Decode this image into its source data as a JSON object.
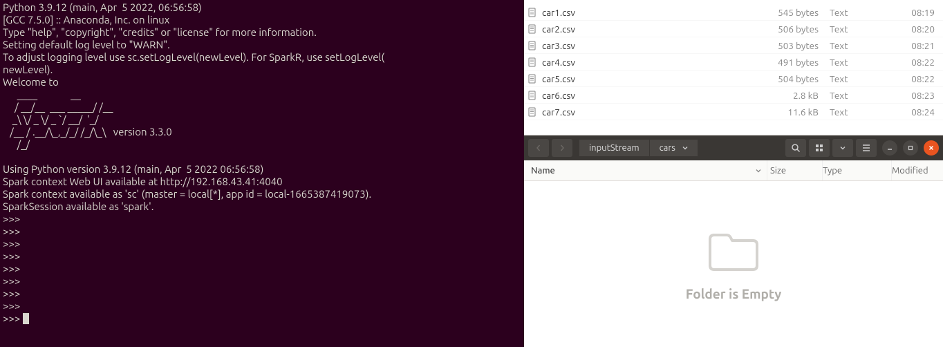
{
  "terminal": {
    "lines": [
      "Python 3.9.12 (main, Apr  5 2022, 06:56:58)",
      "[GCC 7.5.0] :: Anaconda, Inc. on linux",
      "Type \"help\", \"copyright\", \"credits\" or \"license\" for more information.",
      "Setting default log level to \"WARN\".",
      "To adjust logging level use sc.setLogLevel(newLevel). For SparkR, use setLogLevel(",
      "newLevel).",
      "Welcome to",
      "      ____              __",
      "     / __/__  ___ _____/ /__",
      "    _\\ \\/ _ \\/ _ `/ __/  '_/",
      "   /__ / .__/\\_,_/_/ /_/\\_\\   version 3.3.0",
      "      /_/",
      "",
      "Using Python version 3.9.12 (main, Apr  5 2022 06:56:58)",
      "Spark context Web UI available at http://192.168.43.41:4040",
      "Spark context available as 'sc' (master = local[*], app id = local-1665387419073).",
      "SparkSession available as 'spark'.",
      ">>> ",
      ">>> ",
      ">>> ",
      ">>> ",
      ">>> ",
      ">>> ",
      ">>> ",
      ">>> ",
      ">>> "
    ]
  },
  "fm_top": {
    "files": [
      {
        "name": "car1.csv",
        "size": "545 bytes",
        "type": "Text",
        "modified": "08:19"
      },
      {
        "name": "car2.csv",
        "size": "506 bytes",
        "type": "Text",
        "modified": "08:20"
      },
      {
        "name": "car3.csv",
        "size": "503 bytes",
        "type": "Text",
        "modified": "08:21"
      },
      {
        "name": "car4.csv",
        "size": "491 bytes",
        "type": "Text",
        "modified": "08:22"
      },
      {
        "name": "car5.csv",
        "size": "504 bytes",
        "type": "Text",
        "modified": "08:22"
      },
      {
        "name": "car6.csv",
        "size": "2.8 kB",
        "type": "Text",
        "modified": "08:23"
      },
      {
        "name": "car7.csv",
        "size": "11.6 kB",
        "type": "Text",
        "modified": "08:24"
      }
    ]
  },
  "fm_bottom": {
    "breadcrumbs": [
      "inputStream",
      "cars"
    ],
    "columns": {
      "name": "Name",
      "size": "Size",
      "type": "Type",
      "modified": "Modified"
    },
    "empty_label": "Folder is Empty"
  }
}
